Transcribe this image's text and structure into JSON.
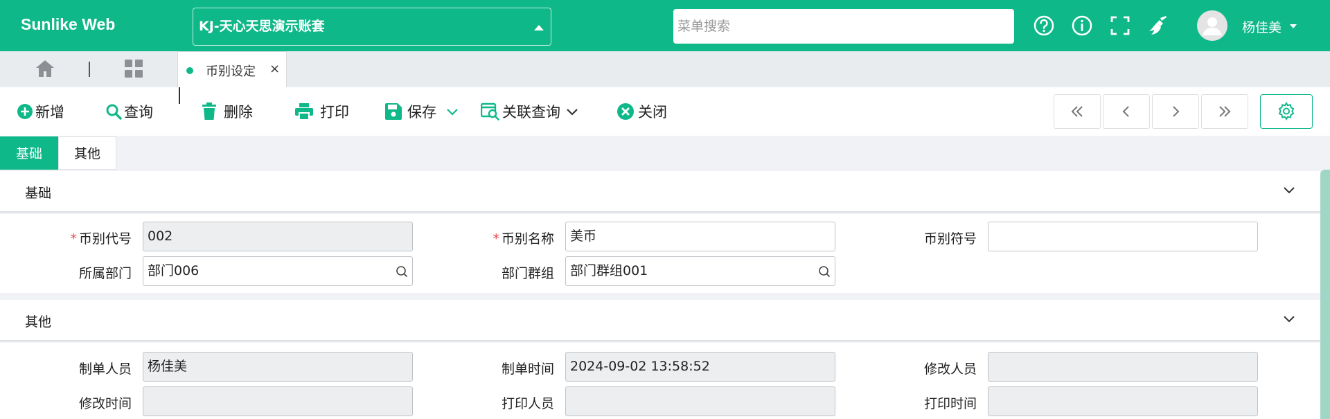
{
  "header": {
    "brand": "Sunlike Web",
    "account": "KJ-天心天思演示账套",
    "search_placeholder": "菜单搜索",
    "user_name": "杨佳美"
  },
  "tabstrip": {
    "active_tab": "币别设定",
    "close_glyph": "×"
  },
  "toolbar": {
    "new": "新增",
    "query": "查询",
    "delete": "删除",
    "print": "打印",
    "save": "保存",
    "related_query": "关联查询",
    "close": "关闭"
  },
  "section_tabs": [
    "基础",
    "其他"
  ],
  "sections": {
    "basic": {
      "title": "基础",
      "fields": {
        "currency_code_label": "币别代号",
        "currency_code_value": "002",
        "currency_name_label": "币别名称",
        "currency_name_value": "美币",
        "currency_symbol_label": "币别符号",
        "currency_symbol_value": "",
        "department_label": "所属部门",
        "department_value": "部门006",
        "dept_group_label": "部门群组",
        "dept_group_value": "部门群组001"
      }
    },
    "other": {
      "title": "其他",
      "fields": {
        "creator_label": "制单人员",
        "creator_value": "杨佳美",
        "create_time_label": "制单时间",
        "create_time_value": "2024-09-02 13:58:52",
        "modifier_label": "修改人员",
        "modifier_value": "",
        "modify_time_label": "修改时间",
        "modify_time_value": "",
        "printer_label": "打印人员",
        "printer_value": "",
        "print_time_label": "打印时间",
        "print_time_value": ""
      }
    }
  },
  "colors": {
    "brand": "#0fb889",
    "required": "#e5484d"
  }
}
